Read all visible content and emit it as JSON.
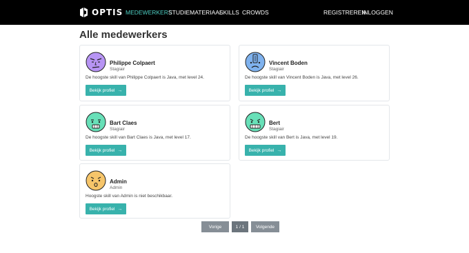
{
  "brand": {
    "name": "OPTIS"
  },
  "nav": {
    "medewerkers": "MEDEWERKERS",
    "studiemateriaal": "STUDIEMATERIAAL",
    "skills": "SKILLS",
    "crowds": "CROWDS",
    "registreren": "REGISTREREN",
    "inloggen": "INLOGGEN"
  },
  "page": {
    "title": "Alle medewerkers"
  },
  "employees": [
    {
      "name": "Philippe Colpaert",
      "role": "Stagiair",
      "skill_text": "De hoogste skill van Philippe Colpaert is Java, met level 24.",
      "button": "Bekijk profiel",
      "avatar_color": "#b794f4"
    },
    {
      "name": "Vincent Boden",
      "role": "Stagiair",
      "skill_text": "De hoogste skill van Vincent Boden is Java, met level 26.",
      "button": "Bekijk profiel",
      "avatar_color": "#7fb2ee"
    },
    {
      "name": "Bart Claes",
      "role": "Stagiair",
      "skill_text": "De hoogste skill van Bart Claes is Java, met level 17.",
      "button": "Bekijk profiel",
      "avatar_color": "#68e0b8"
    },
    {
      "name": "Bert",
      "role": "Stagiair",
      "skill_text": "De hoogste skill van Bert is Java, met level 19.",
      "button": "Bekijk profiel",
      "avatar_color": "#68e0b8"
    },
    {
      "name": "Admin",
      "role": "Admin",
      "skill_text": "Hoogste skill van Admin is niet beschikbaar.",
      "button": "Bekijk profiel",
      "avatar_color": "#f6c56a"
    }
  ],
  "pagination": {
    "previous": "Vorige",
    "current": "1 / 1",
    "next": "Volgende"
  },
  "colors": {
    "navbar": "#000000",
    "active_link": "#4fd1c5",
    "button": "#38b2ac",
    "pager": "#868e96"
  }
}
